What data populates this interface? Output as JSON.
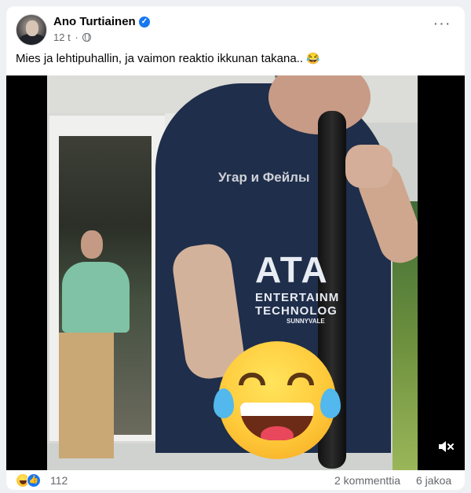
{
  "post": {
    "author": "Ano Turtiainen",
    "time": "12 t",
    "separator": "·",
    "text": "Mies ja lehtipuhallin, ja vaimon reaktio ikkunan takana..",
    "text_emoji": "😂",
    "more_label": "···"
  },
  "video": {
    "watermark": "Угар и Фейлы",
    "shirt_lines": [
      "ATA",
      "ENTERTAINM",
      "TECHNOLOG",
      "SUNNYVALE"
    ],
    "overlay_emoji": "face-with-tears-of-joy",
    "mute_icon": "speaker-muted-icon"
  },
  "footer": {
    "reaction_count": "112",
    "comments": "2 kommenttia",
    "shares": "6 jakoa"
  },
  "colors": {
    "link_blue": "#1877f2",
    "secondary_text": "#65676b",
    "background": "#eef0f3"
  }
}
